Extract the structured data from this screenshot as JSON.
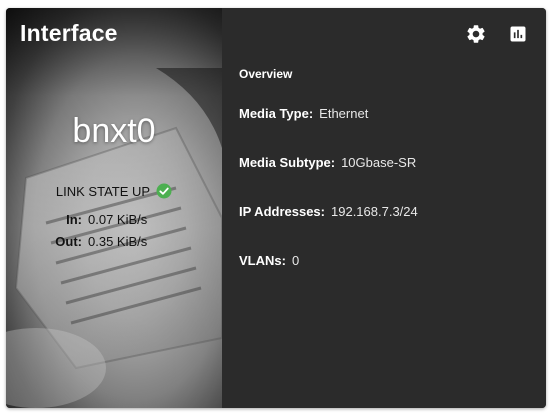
{
  "card": {
    "title": "Interface"
  },
  "interface": {
    "name": "bnxt0",
    "link_state": "LINK STATE UP",
    "traffic": [
      {
        "label": "In:",
        "value": "0.07 KiB/s"
      },
      {
        "label": "Out:",
        "value": "0.35 KiB/s"
      }
    ]
  },
  "toolbar": {
    "settings_icon": "gear-icon",
    "reports_icon": "bar-chart-icon"
  },
  "overview": {
    "heading": "Overview",
    "properties": [
      {
        "label": "Media Type:",
        "value": "Ethernet"
      },
      {
        "label": "Media Subtype:",
        "value": "10Gbase-SR"
      },
      {
        "label": "IP Addresses:",
        "value": "192.168.7.3/24"
      },
      {
        "label": "VLANs:",
        "value": "0"
      }
    ]
  },
  "colors": {
    "card_bg": "#2b2b2b",
    "status_ok": "#4caf50",
    "text_light": "#ffffff",
    "text_dark": "#111111"
  }
}
